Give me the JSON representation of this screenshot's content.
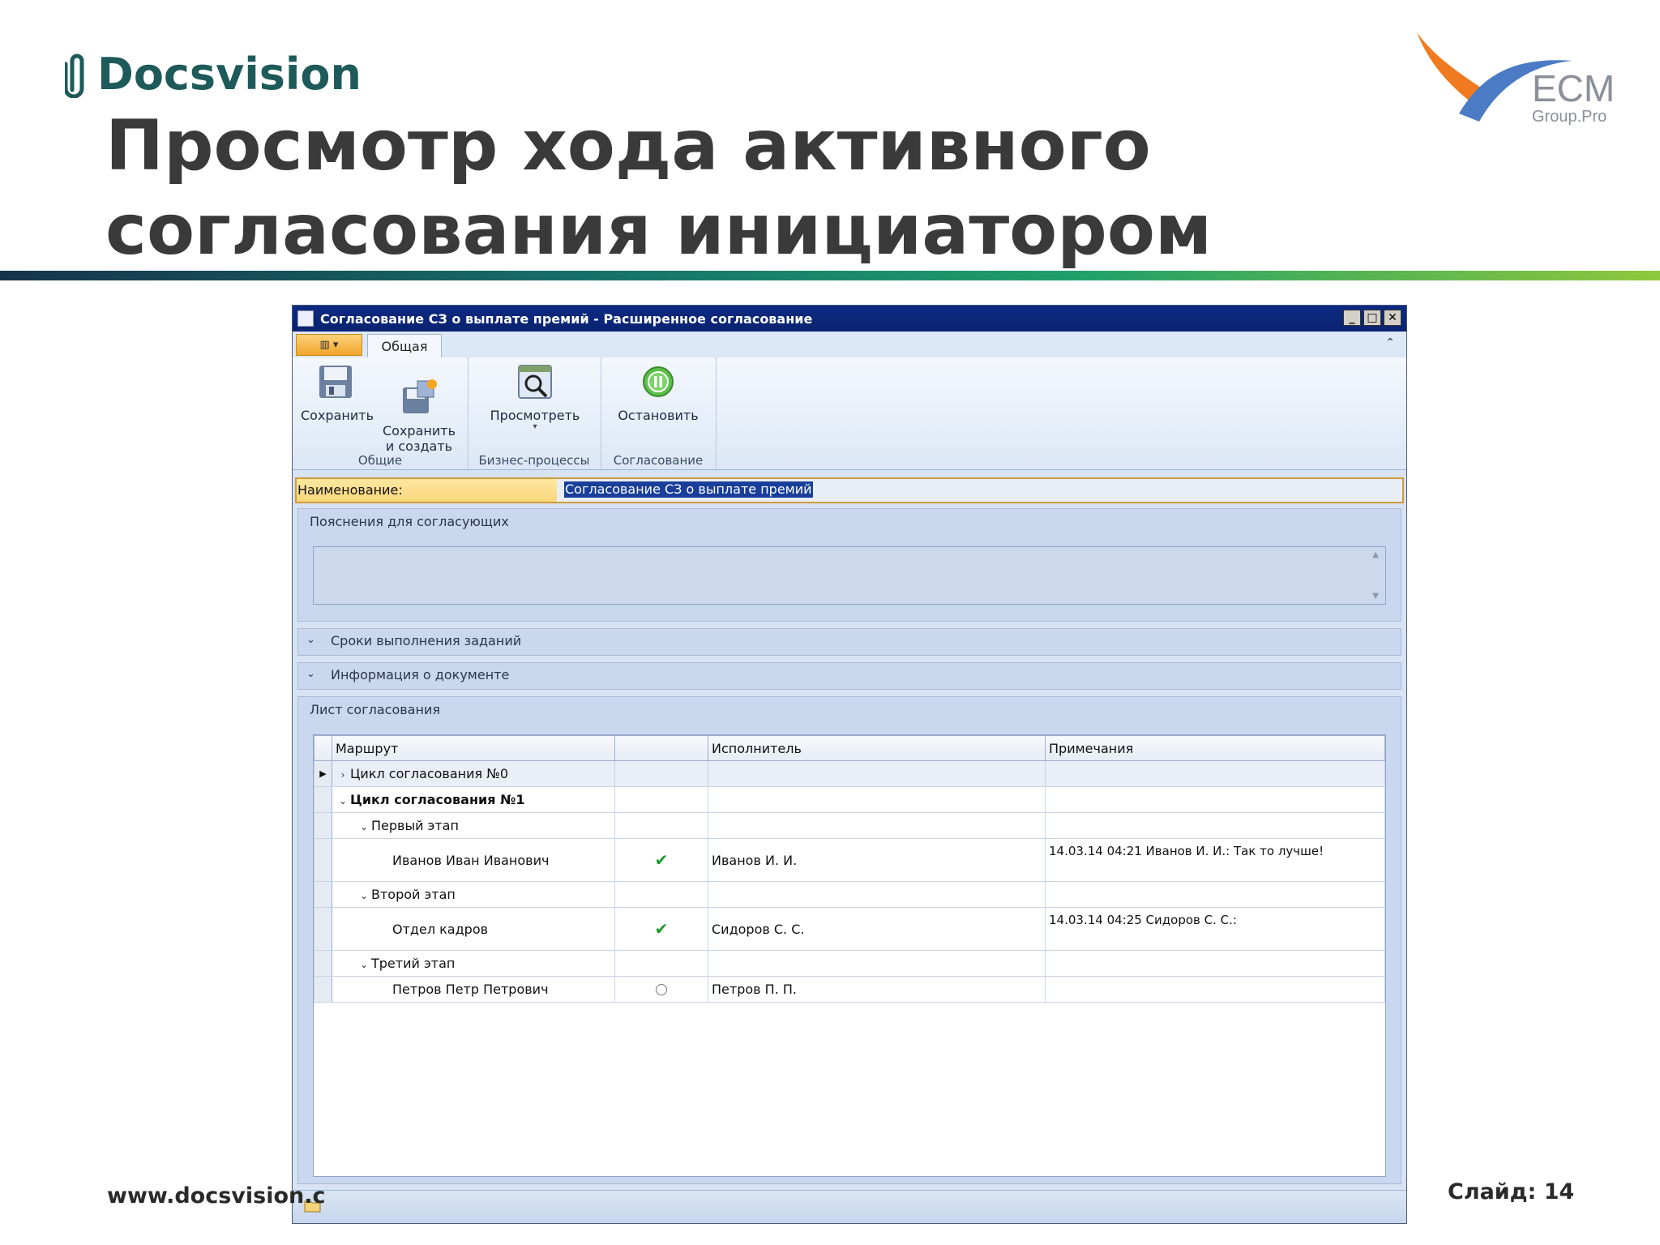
{
  "slide": {
    "logo_text": "Docsvision",
    "title": "Просмотр хода активного согласования инициатором",
    "ecm_logo_text": "ECM",
    "ecm_logo_sub": "Group.Pro",
    "footer_url": "www.docsvision.c",
    "slide_number": "Слайд: 14"
  },
  "window": {
    "title": "Согласование СЗ о выплате премий - Расширенное согласование",
    "buttons": [
      "_",
      "□",
      "✕"
    ]
  },
  "ribbon": {
    "tab": "Общая",
    "groups": [
      {
        "label": "Общие",
        "buttons": [
          {
            "label": "Сохранить",
            "icon": "save-icon"
          },
          {
            "label": "Сохранить\nи создать",
            "icon": "save-and-create-icon"
          }
        ]
      },
      {
        "label": "Бизнес-процессы",
        "buttons": [
          {
            "label": "Просмотреть",
            "icon": "view-process-icon"
          }
        ]
      },
      {
        "label": "Согласование",
        "buttons": [
          {
            "label": "Остановить",
            "icon": "pause-icon"
          }
        ]
      }
    ]
  },
  "name_field": {
    "label": "Наименование:",
    "value": "Согласование СЗ о выплате премий"
  },
  "panels": {
    "explanations": "Пояснения для согласующих",
    "deadlines": "Сроки выполнения заданий",
    "doc_info": "Информация о документе",
    "approval_sheet": "Лист согласования"
  },
  "grid": {
    "columns": [
      "Маршрут",
      "",
      "Исполнитель",
      "Примечания"
    ],
    "rows": [
      {
        "level": 0,
        "expander": "›",
        "route": "Цикл согласования №0",
        "status": "",
        "performer": "",
        "note": "",
        "bold": false
      },
      {
        "level": 0,
        "expander": "⌄",
        "route": "Цикл согласования №1",
        "status": "",
        "performer": "",
        "note": "",
        "bold": true
      },
      {
        "level": 1,
        "expander": "⌄",
        "route": "Первый этап",
        "status": "",
        "performer": "",
        "note": "",
        "bold": false
      },
      {
        "level": 2,
        "expander": "",
        "route": "Иванов Иван Иванович",
        "status": "ok",
        "performer": "Иванов И. И.",
        "note": "14.03.14 04:21 Иванов И. И.: Так то лучше!",
        "bold": false
      },
      {
        "level": 1,
        "expander": "⌄",
        "route": "Второй этап",
        "status": "",
        "performer": "",
        "note": "",
        "bold": false
      },
      {
        "level": 2,
        "expander": "",
        "route": "Отдел кадров",
        "status": "ok",
        "performer": "Сидоров С. С.",
        "note": "14.03.14 04:25 Сидоров С. С.:",
        "bold": false
      },
      {
        "level": 1,
        "expander": "⌄",
        "route": "Третий этап",
        "status": "",
        "performer": "",
        "note": "",
        "bold": false
      },
      {
        "level": 2,
        "expander": "",
        "route": "Петров Петр Петрович",
        "status": "waiting",
        "performer": "Петров П. П.",
        "note": "",
        "bold": false
      }
    ]
  },
  "colors": {
    "title_bar": "#0d2a82",
    "logo": "#1e5a5a",
    "accent_orange": "#f3a52b",
    "check": "#1c9a2a"
  }
}
